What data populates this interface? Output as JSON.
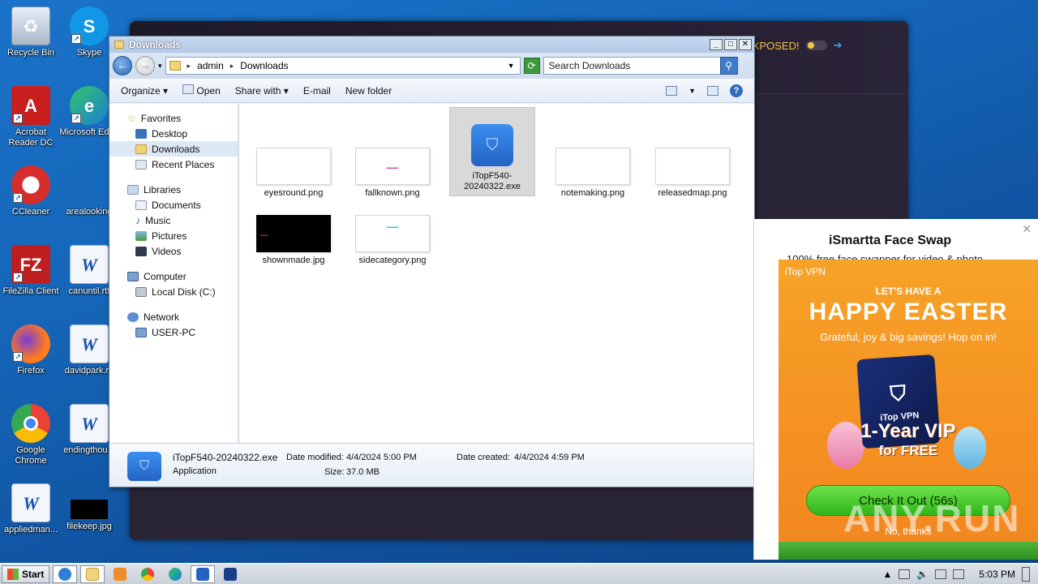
{
  "desktop": {
    "icons": [
      {
        "label": "Recycle Bin"
      },
      {
        "label": "Skype"
      },
      {
        "label": "Acrobat Reader DC"
      },
      {
        "label": "Microsoft Edge"
      },
      {
        "label": "CCleaner"
      },
      {
        "label": "arealooking"
      },
      {
        "label": "FileZilla Client"
      },
      {
        "label": "canuntil.rtf"
      },
      {
        "label": "Firefox"
      },
      {
        "label": "davidpark.rtf"
      },
      {
        "label": "Google Chrome"
      },
      {
        "label": "endingthou..."
      },
      {
        "label": "appliedman..."
      },
      {
        "label": "filekeep.jpg"
      }
    ]
  },
  "bg_app": {
    "exposed_text": "You may be EXPOSED!"
  },
  "explorer": {
    "title": "Downloads",
    "breadcrumb": [
      "admin",
      "Downloads"
    ],
    "search_placeholder": "Search Downloads",
    "toolbar": {
      "organize": "Organize",
      "open": "Open",
      "share_with": "Share with",
      "email": "E-mail",
      "new_folder": "New folder"
    },
    "nav": {
      "favorites": "Favorites",
      "desktop": "Desktop",
      "downloads": "Downloads",
      "recent_places": "Recent Places",
      "libraries": "Libraries",
      "documents": "Documents",
      "music": "Music",
      "pictures": "Pictures",
      "videos": "Videos",
      "computer": "Computer",
      "local_disk": "Local Disk (C:)",
      "network": "Network",
      "user_pc": "USER-PC"
    },
    "files": [
      {
        "name": "eyesround.png"
      },
      {
        "name": "fallknown.png"
      },
      {
        "name": "iTopF540-20240322.exe"
      },
      {
        "name": "notemaking.png"
      },
      {
        "name": "releasedmap.png"
      },
      {
        "name": "shownmade.jpg"
      },
      {
        "name": "sidecategory.png"
      }
    ],
    "details": {
      "filename": "iTopF540-20240322.exe",
      "type": "Application",
      "modified_label": "Date modified:",
      "modified_value": "4/4/2024 5:00 PM",
      "size_label": "Size:",
      "size_value": "37.0 MB",
      "created_label": "Date created:",
      "created_value": "4/4/2024 4:59 PM"
    }
  },
  "ad": {
    "title": "iSmartta Face Swap",
    "subtitle": "100% free face swapper for video & photo",
    "brand": "iTop VPN",
    "headline_small": "LET'S HAVE A",
    "headline_big": "HAPPY EASTER",
    "tagline": "Grateful, joy & big savings! Hop on in!",
    "box_label": "iTop VPN",
    "vip": "1-Year VIP",
    "free": "for FREE",
    "cta": "Check It Out (56s)",
    "decline": "No, thanks",
    "watermark": "ANY.RUN"
  },
  "taskbar": {
    "start": "Start",
    "clock": "5:03 PM"
  }
}
